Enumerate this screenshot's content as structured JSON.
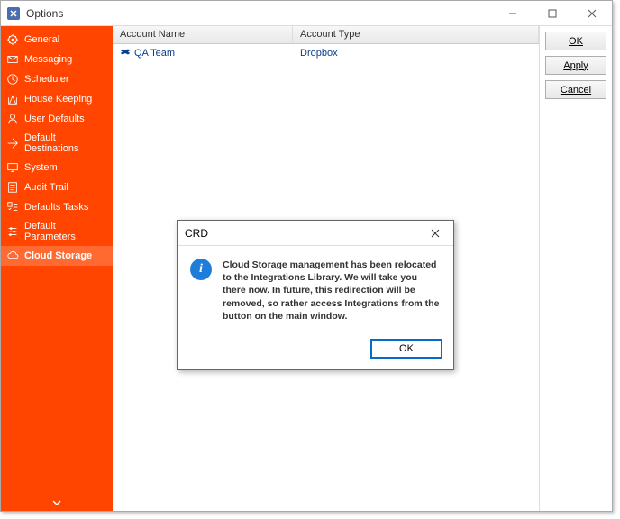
{
  "window": {
    "title": "Options"
  },
  "sidebar": {
    "items": [
      {
        "label": "General"
      },
      {
        "label": "Messaging"
      },
      {
        "label": "Scheduler"
      },
      {
        "label": "House Keeping"
      },
      {
        "label": "User Defaults"
      },
      {
        "label": "Default Destinations"
      },
      {
        "label": "System"
      },
      {
        "label": "Audit Trail"
      },
      {
        "label": "Defaults Tasks"
      },
      {
        "label": "Default Parameters"
      },
      {
        "label": "Cloud Storage"
      }
    ]
  },
  "table": {
    "headers": {
      "name": "Account Name",
      "type": "Account Type"
    },
    "rows": [
      {
        "name": "QA Team",
        "type": "Dropbox"
      }
    ]
  },
  "buttons": {
    "ok": "OK",
    "apply": "Apply",
    "cancel": "Cancel"
  },
  "dialog": {
    "title": "CRD",
    "message": "Cloud Storage management has been relocated to the Integrations Library. We will take you there now. In future, this redirection will be removed, so rather access Integrations from the button on the main window.",
    "ok": "OK"
  }
}
